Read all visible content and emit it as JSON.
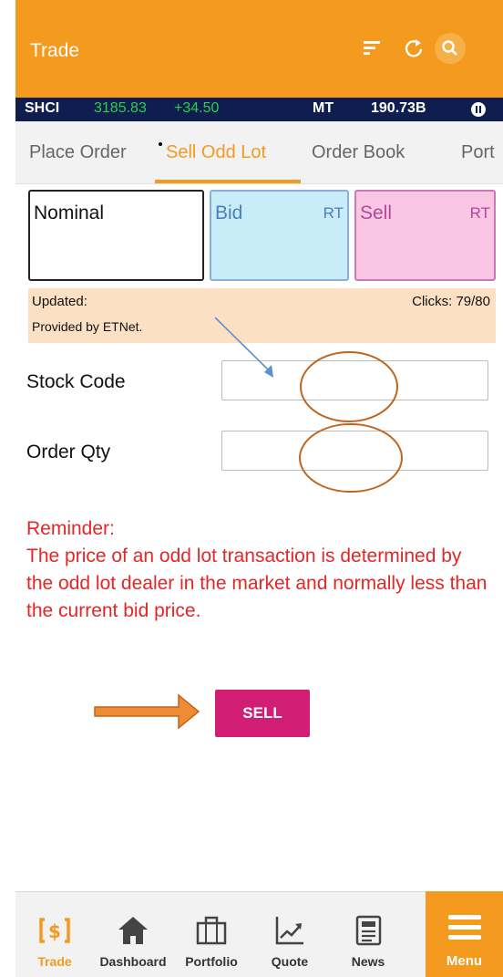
{
  "header": {
    "title": "Trade"
  },
  "ticker": {
    "index": "SHCI",
    "value": "3185.83",
    "change": "+34.50",
    "mt_label": "MT",
    "mt_value": "190.73B"
  },
  "tabs": [
    {
      "label": "Place Order"
    },
    {
      "label": "Sell Odd Lot"
    },
    {
      "label": "Order Book"
    },
    {
      "label": "Port"
    }
  ],
  "price_boxes": {
    "nominal": "Nominal",
    "bid": "Bid",
    "bid_tag": "RT",
    "sell": "Sell",
    "sell_tag": "RT"
  },
  "info": {
    "updated": "Updated:",
    "provider": "Provided by ETNet.",
    "clicks": "Clicks: 79/80"
  },
  "form": {
    "stock_code_label": "Stock Code",
    "stock_code_value": "",
    "order_qty_label": "Order Qty",
    "order_qty_value": ""
  },
  "reminder": "Reminder:\nThe price of an odd lot transaction is determined by the odd lot dealer in the market and normally less than the current bid price.",
  "sell_button": "SELL",
  "bottom_nav": [
    {
      "label": "Trade",
      "icon": "dollar-arrows-icon"
    },
    {
      "label": "Dashboard",
      "icon": "home-icon"
    },
    {
      "label": "Portfolio",
      "icon": "briefcase-icon"
    },
    {
      "label": "Quote",
      "icon": "chart-trend-icon"
    },
    {
      "label": "News",
      "icon": "newspaper-icon"
    },
    {
      "label": "Menu",
      "icon": "hamburger-icon"
    }
  ],
  "colors": {
    "accent": "#f39a1f",
    "ticker_bg": "#0f1d4f",
    "sell_button": "#d11d74",
    "reminder": "#e32626"
  }
}
